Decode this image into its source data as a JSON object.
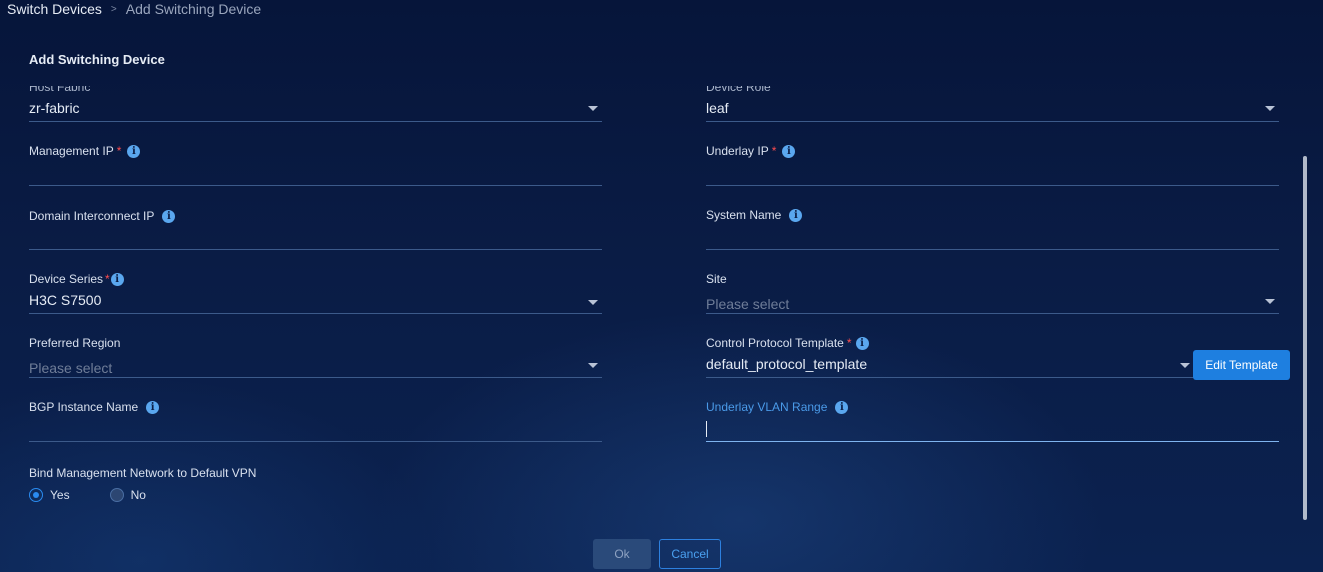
{
  "breadcrumb": {
    "root": "Switch Devices",
    "separator": ">",
    "current": "Add Switching Device"
  },
  "panel": {
    "title": "Add Switching Device"
  },
  "fields": {
    "host_fabric": {
      "label": "Host Fabric",
      "value": "zr-fabric"
    },
    "device_role": {
      "label": "Device Role",
      "value": "leaf"
    },
    "management_ip": {
      "label": "Management IP",
      "required": "*",
      "value": ""
    },
    "underlay_ip": {
      "label": "Underlay IP",
      "required": "*",
      "value": ""
    },
    "domain_interconnect_ip": {
      "label": "Domain Interconnect IP",
      "value": ""
    },
    "system_name": {
      "label": "System Name",
      "value": ""
    },
    "device_series": {
      "label": "Device Series",
      "required": "*",
      "value": "H3C S7500"
    },
    "site": {
      "label": "Site",
      "placeholder": "Please select"
    },
    "preferred_region": {
      "label": "Preferred Region",
      "placeholder": "Please select"
    },
    "control_protocol_template": {
      "label": "Control Protocol Template",
      "required": "*",
      "value": "default_protocol_template"
    },
    "bgp_instance_name": {
      "label": "BGP Instance Name",
      "value": ""
    },
    "underlay_vlan_range": {
      "label": "Underlay VLAN Range",
      "value": ""
    }
  },
  "edit_template_button": "Edit Template",
  "bind_mgmt": {
    "label": "Bind Management Network to Default VPN",
    "options": [
      {
        "label": "Yes",
        "checked": true
      },
      {
        "label": "No",
        "checked": false
      }
    ]
  },
  "buttons": {
    "ok": "Ok",
    "cancel": "Cancel"
  },
  "icons": {
    "info": "info-icon",
    "caret": "chevron-down-icon"
  },
  "colors": {
    "accent": "#1e7fe0",
    "required": "#ff4d4f",
    "active_label": "#4a9ae8"
  }
}
